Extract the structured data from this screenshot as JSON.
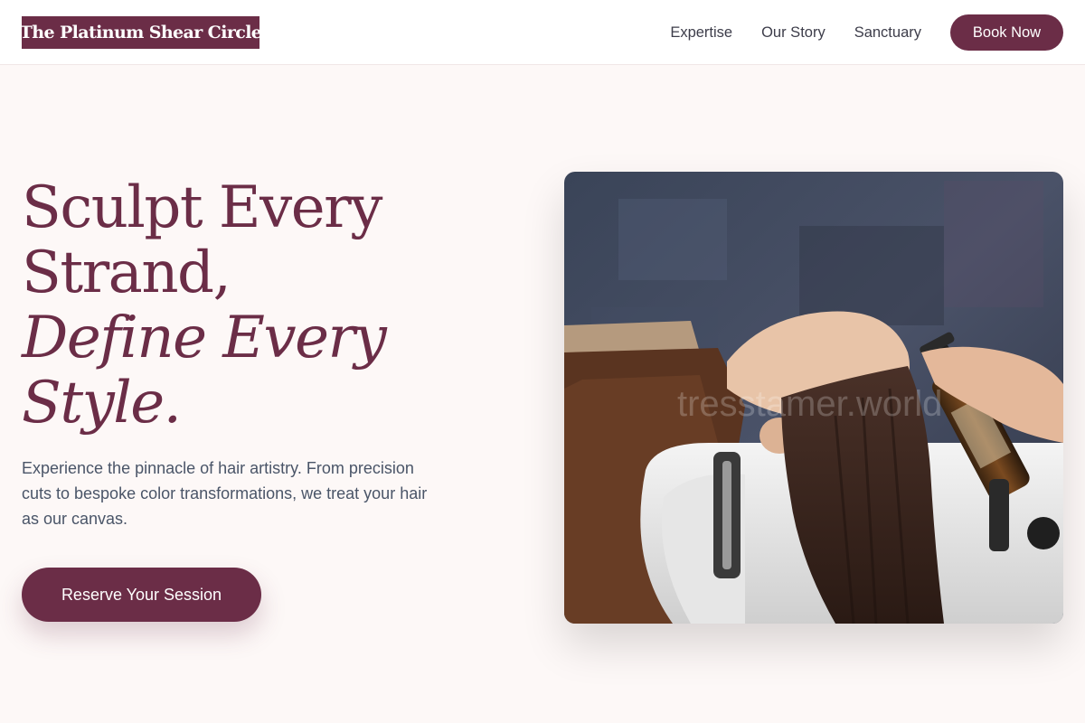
{
  "header": {
    "logo_text": "The Platinum Shear Circle",
    "nav": [
      "Expertise",
      "Our Story",
      "Sanctuary"
    ],
    "book_label": "Book Now"
  },
  "hero": {
    "title_line1": "Sculpt Every",
    "title_line2": "Strand,",
    "title_line3": "Define Every",
    "title_line4": "Style.",
    "subtitle": "Experience the pinnacle of hair artistry. From precision cuts to bespoke color transformations, we treat your hair as our canvas.",
    "cta_label": "Reserve Your Session"
  },
  "photo": {
    "watermark": "tresstamer.world"
  },
  "colors": {
    "brand": "#6b2d47",
    "page_bg": "#fdf8f7",
    "body_text": "#4a5568"
  }
}
